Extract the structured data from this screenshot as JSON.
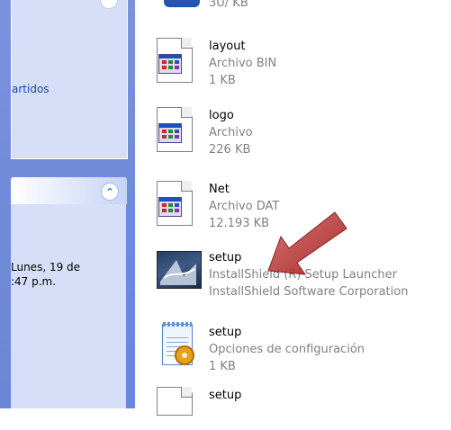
{
  "task_pane": {
    "panel_fragment": "artidos",
    "details": {
      "date_text": "Lunes, 19 de\n:47 p.m."
    }
  },
  "top_fragment": {
    "sub": "3U/ KB"
  },
  "files": [
    {
      "name": "layout",
      "type": "Archivo BIN",
      "size": "1 KB",
      "icon": "app-document-icon"
    },
    {
      "name": "logo",
      "type": "Archivo",
      "size": "226 KB",
      "icon": "app-document-icon"
    },
    {
      "name": "Net",
      "type": "Archivo DAT",
      "size": "12.193 KB",
      "icon": "app-document-icon"
    },
    {
      "name": "setup",
      "type": "InstallShield (R) Setup Launcher",
      "size": "InstallShield Software Corporation",
      "icon": "installshield-icon"
    },
    {
      "name": "setup",
      "type": "Opciones de configuración",
      "size": "1 KB",
      "icon": "setup-ini-icon"
    },
    {
      "name": "setup",
      "type": "",
      "size": "",
      "icon": "document-icon"
    }
  ],
  "colors": {
    "task_pane_bg": "#6f8ad8",
    "panel_bg": "#d6dff7",
    "link": "#1c47a7",
    "subtext": "#808080",
    "arrow": "#b02a2a"
  }
}
